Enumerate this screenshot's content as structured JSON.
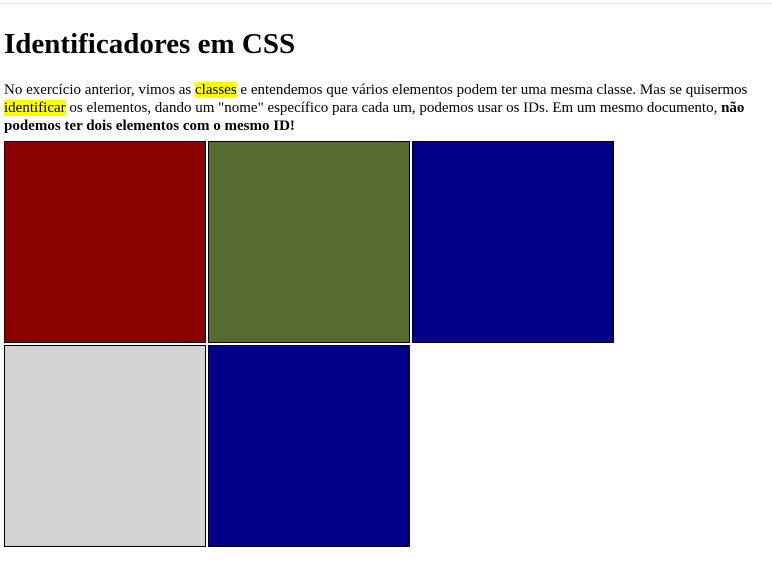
{
  "page": {
    "heading": "Identificadores em CSS",
    "paragraph": {
      "t1": "No exercício anterior, vimos as ",
      "hl1": "classes",
      "t2": " e entendemos que vários elementos podem ter uma mesma classe. Mas se quisermos ",
      "hl2": "identificar",
      "t3": " os elementos, dando um \"nome\" específico para cada um, podemos usar os IDs. Em um mesmo documento, ",
      "bold": "não podemos ter dois elementos com o mesmo ID!"
    }
  },
  "boxes": [
    {
      "color": "#8b0000"
    },
    {
      "color": "#556b2f"
    },
    {
      "color": "#00008b"
    },
    {
      "color": "#d3d3d3"
    },
    {
      "color": "#00008b"
    }
  ],
  "colors": {
    "highlight": "#ffff00"
  }
}
